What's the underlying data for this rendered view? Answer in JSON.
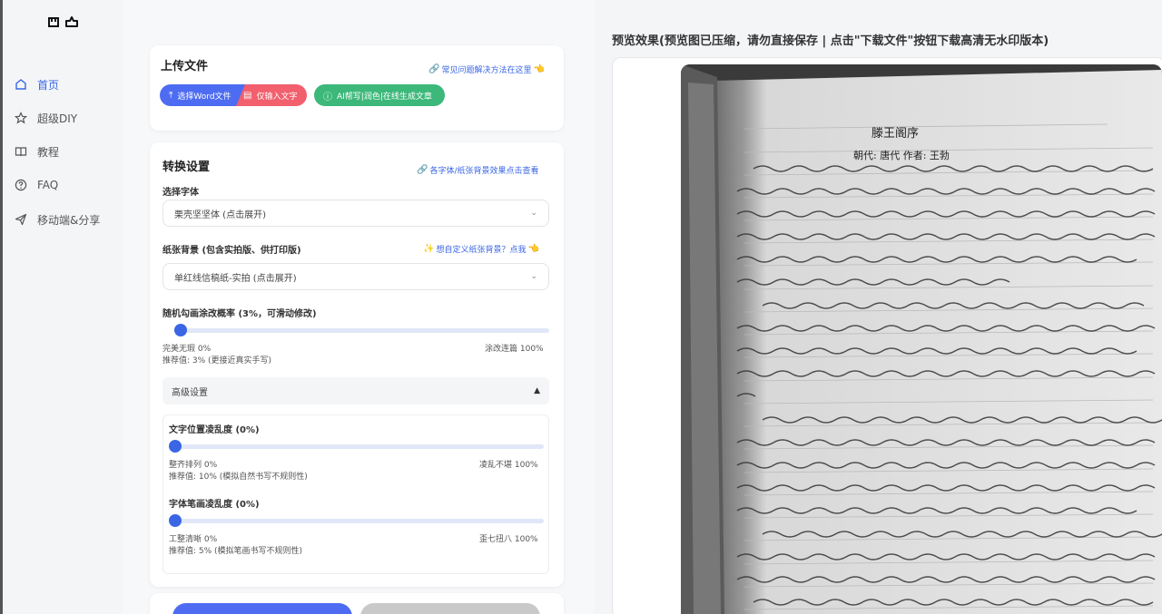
{
  "nav": {
    "items": [
      {
        "label": "首页",
        "icon": "home-icon",
        "active": true
      },
      {
        "label": "超级DIY",
        "icon": "star-icon"
      },
      {
        "label": "教程",
        "icon": "book-icon"
      },
      {
        "label": "FAQ",
        "icon": "question-icon"
      },
      {
        "label": "移动端&分享",
        "icon": "send-icon"
      }
    ]
  },
  "upload": {
    "title": "上传文件",
    "faq_link": "常见问题解决方法在这里",
    "btn_word": "选择Word文件",
    "btn_text": "仅输入文字",
    "btn_ai": "AI帮写|润色|在线生成文章"
  },
  "settings": {
    "title": "转换设置",
    "effects_link": "各字体/纸张背景效果点击查看",
    "font_label": "选择字体",
    "font_value": "栗壳坚坚体 (点击展开)",
    "paper_label": "纸张背景 (包含实拍版、供打印版)",
    "paper_link": "想自定义纸张背景？点我",
    "paper_value": "单红线信稿纸-实拍 (点击展开)",
    "correction_label": "随机勾画涂改概率 (3%，可滑动修改)",
    "correction_value": 0.03,
    "correction_min": "完美无瑕 0%",
    "correction_max": "涂改连篇 100%",
    "correction_hint": "推荐值: 3% (更接近真实手写)",
    "advanced_label": "高级设置",
    "pos_label": "文字位置凌乱度 (0%)",
    "pos_value": 0,
    "pos_min": "整齐排列 0%",
    "pos_max": "凌乱不堪 100%",
    "pos_hint": "推荐值: 10% (模拟自然书写不规则性)",
    "stroke_label": "字体笔画凌乱度 (0%)",
    "stroke_value": 0,
    "stroke_min": "工整清晰 0%",
    "stroke_max": "歪七扭八 100%",
    "stroke_hint": "推荐值: 5% (模拟笔画书写不规则性)"
  },
  "preview": {
    "title": "预览效果(预览图已压缩，请勿直接保存 | 点击\"下载文件\"按钮下载高清无水印版本)",
    "poem_title": "滕王阁序",
    "poem_subtitle": "朝代: 唐代 作者: 王勃"
  },
  "colors": {
    "accent": "#3a66e6",
    "red": "#f25f6d",
    "green": "#3cb87a"
  }
}
